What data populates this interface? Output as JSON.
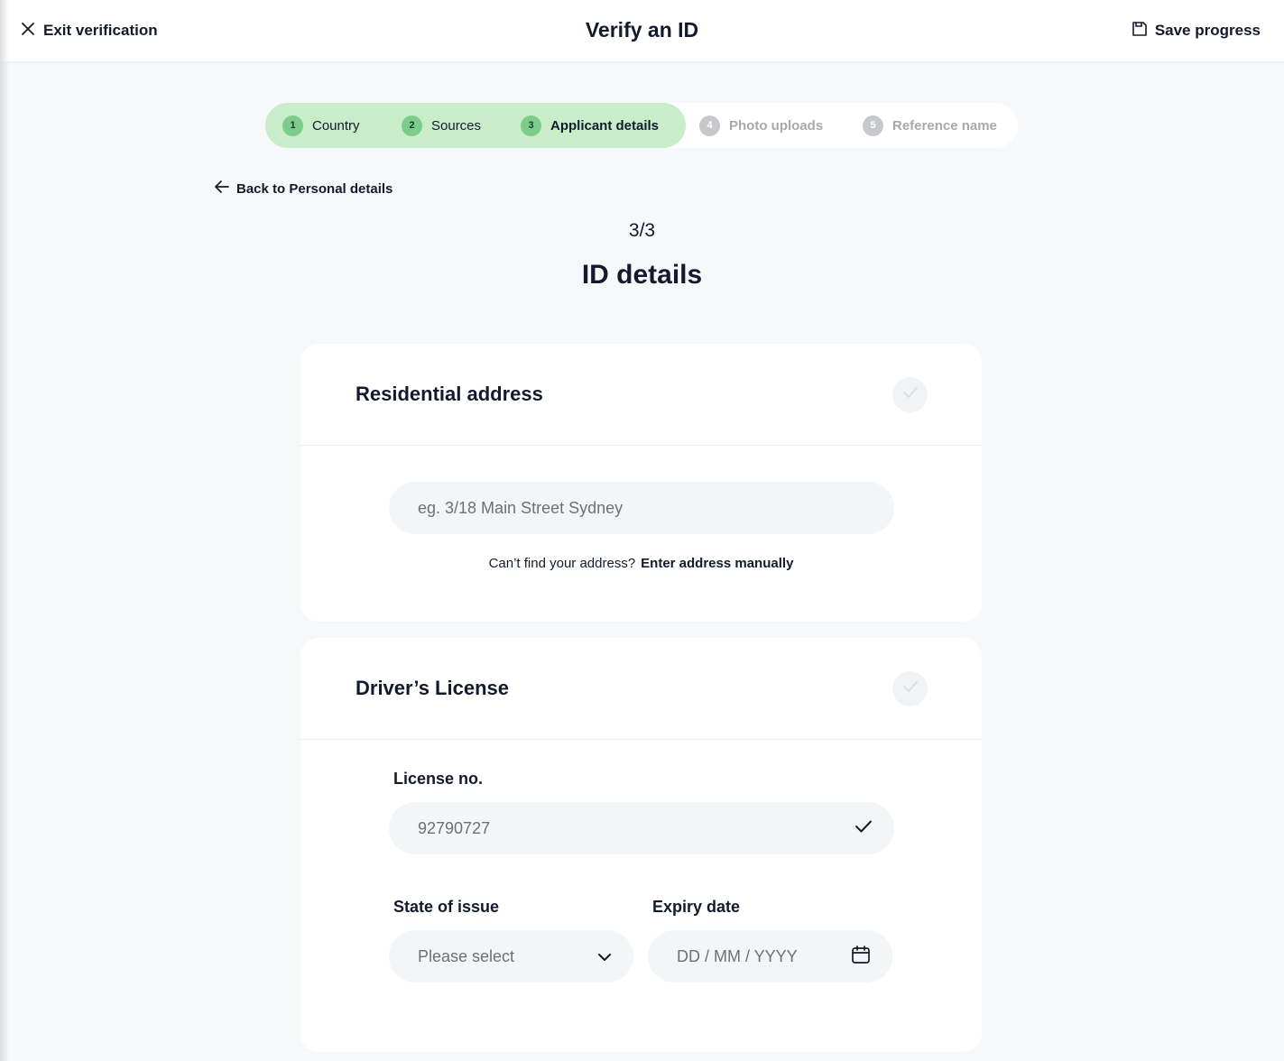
{
  "header": {
    "exit_label": "Exit verification",
    "title": "Verify an ID",
    "save_label": "Save progress"
  },
  "stepper": {
    "steps": [
      {
        "number": "1",
        "label": "Country",
        "status": "done"
      },
      {
        "number": "2",
        "label": "Sources",
        "status": "done"
      },
      {
        "number": "3",
        "label": "Applicant details",
        "status": "current"
      },
      {
        "number": "4",
        "label": "Photo uploads",
        "status": "todo"
      },
      {
        "number": "5",
        "label": "Reference name",
        "status": "todo"
      }
    ]
  },
  "back_link": "Back to Personal details",
  "step_count": "3/3",
  "page_title": "ID details",
  "address_card": {
    "title": "Residential address",
    "input_placeholder": "eg. 3/18 Main Street Sydney",
    "manual_prompt": "Can’t find your address?",
    "manual_link": "Enter address manually"
  },
  "license_card": {
    "title": "Driver’s License",
    "license_label": "License no.",
    "license_value": "92790727",
    "state_label": "State of issue",
    "state_placeholder": "Please select",
    "expiry_label": "Expiry date",
    "expiry_placeholder": "DD / MM / YYYY"
  },
  "colors": {
    "background": "#f7f8fa",
    "stepper_done": "#c9ecc9",
    "step_badge_done": "#7ccc8c",
    "step_badge_todo": "#c7c8cc",
    "text": "#141a2e"
  }
}
